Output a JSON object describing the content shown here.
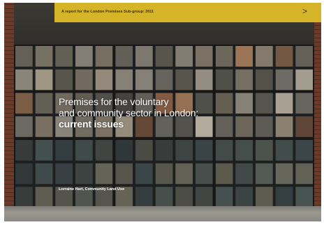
{
  "banner": {
    "text": "A report for the London Premises Sub-group: 2011",
    "arrow": ">",
    "color": "#d6b428"
  },
  "title": {
    "line1": "Premises for the voluntary",
    "line2": "and community sector in London:",
    "line3": "current issues"
  },
  "author": "Lorraine Hart, Community Land Use",
  "colors": {
    "frame": "#1e201f",
    "brick": "#6d3a2a"
  }
}
